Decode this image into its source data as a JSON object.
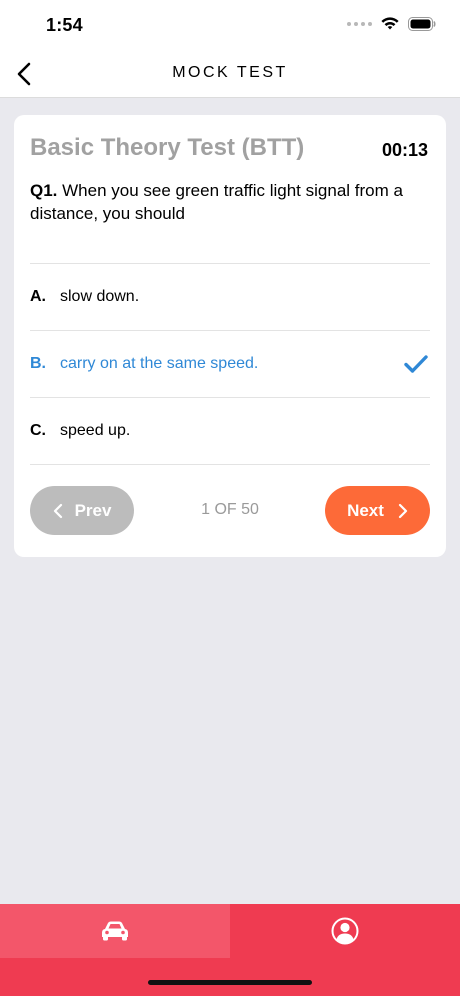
{
  "status_bar": {
    "time": "1:54"
  },
  "nav": {
    "title": "MOCK TEST"
  },
  "test": {
    "title": "Basic Theory Test (BTT)",
    "timer": "00:13",
    "question_number": "Q1.",
    "question_text": "When you see green traffic light signal from a distance, you should",
    "options": [
      {
        "letter": "A.",
        "text": "slow down.",
        "selected": false
      },
      {
        "letter": "B.",
        "text": "carry on at the same speed.",
        "selected": true
      },
      {
        "letter": "C.",
        "text": "speed up.",
        "selected": false
      }
    ]
  },
  "pager": {
    "prev_label": "Prev",
    "next_label": "Next",
    "counter": "1 OF 50"
  },
  "colors": {
    "accent_blue": "#2f88d6",
    "next_orange": "#fd6a38",
    "prev_gray": "#bcbcbc",
    "tab_red": "#ef3b51",
    "tab_active": "#f3566a"
  },
  "tabs": [
    {
      "icon": "car-icon",
      "active": true
    },
    {
      "icon": "profile-icon",
      "active": false
    }
  ]
}
